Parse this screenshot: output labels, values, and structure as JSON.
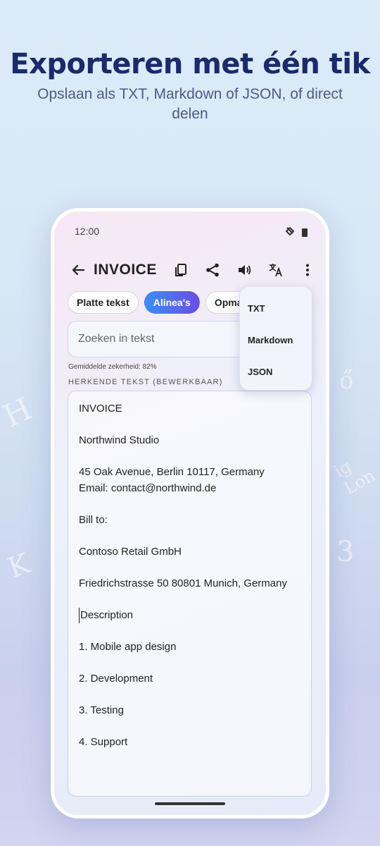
{
  "promo": {
    "headline": "Exporteren met één tik",
    "subline": "Opslaan als TXT, Markdown of JSON, of direct delen"
  },
  "status": {
    "time": "12:00"
  },
  "app_bar": {
    "title": "INVOICE"
  },
  "chips": [
    {
      "label": "Platte tekst",
      "active": false
    },
    {
      "label": "Alinea's",
      "active": true
    },
    {
      "label": "Opmaak",
      "active": false
    }
  ],
  "search": {
    "placeholder": "Zoeken in tekst"
  },
  "confidence": "Gemiddelde zekerheid: 82%",
  "section_label": "HERKENDE TEKST (BEWERKBAAR)",
  "text_lines": [
    "INVOICE",
    "Northwind Studio",
    "45 Oak Avenue, Berlin 10117, Germany\nEmail: contact@northwind.de",
    "Bill to:",
    "Contoso Retail GmbH",
    "Friedrichstrasse 50 80801 Munich, Germany",
    "Description",
    "1. Mobile app design",
    "2. Development",
    "3. Testing",
    "4. Support"
  ],
  "export_menu": {
    "items": [
      "TXT",
      "Markdown",
      "JSON"
    ]
  },
  "colors": {
    "accent_start": "#3b8ef5",
    "accent_end": "#6a4de8",
    "headline": "#1b2a6b"
  }
}
